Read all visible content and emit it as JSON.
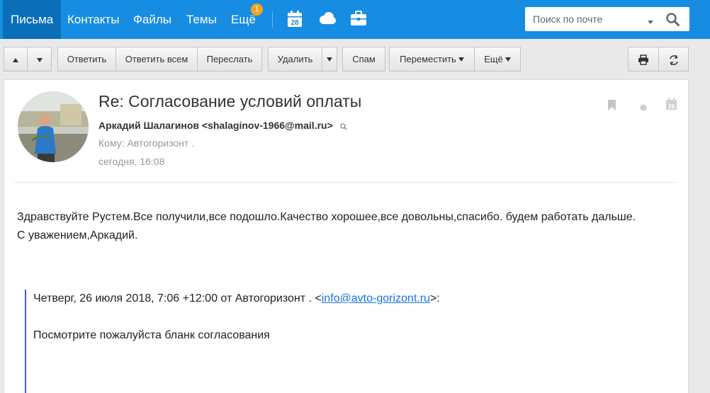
{
  "nav": {
    "items": [
      {
        "label": "Письма",
        "active": true
      },
      {
        "label": "Контакты"
      },
      {
        "label": "Файлы"
      },
      {
        "label": "Темы"
      },
      {
        "label": "Ещё"
      }
    ],
    "badge": "1",
    "calendar_day": "28",
    "search_placeholder": "Поиск по почте"
  },
  "toolbar": {
    "reply": "Ответить",
    "reply_all": "Ответить всем",
    "forward": "Переслать",
    "delete": "Удалить",
    "spam": "Спам",
    "move": "Переместить",
    "more": "Ещё"
  },
  "message": {
    "subject": "Re: Согласование условий оплаты",
    "sender": "Аркадий Шалагинов <shalaginov-1966@mail.ru>",
    "to": "Кому: Автогоризонт .",
    "date": "сегодня, 16:08",
    "calendar_day": "28",
    "body_line1": "Здравствуйте Рустем.Все получили,все подошло.Качество хорошее,все довольны,спасибо. будем работать дальше.",
    "body_line2": "С уважением,Аркадий.",
    "quote_prefix": "Четверг, 26 июля 2018, 7:06 +12:00 от Автогоризонт . <",
    "quote_link": "info@avto-gorizont.ru",
    "quote_suffix": ">:",
    "quote_body": "Посмотрите пожалуйста бланк согласования"
  },
  "colors": {
    "topbar": "#168de2",
    "active_tab": "#0a6fb8",
    "badge": "#f7a21b",
    "quote_bar": "#3a5fcd",
    "link": "#1a73e8"
  },
  "icons": [
    "calendar-icon",
    "cloud-icon",
    "briefcase-icon",
    "search-icon",
    "arrow-up-icon",
    "arrow-down-icon",
    "print-icon",
    "translate-icon",
    "bookmark-icon",
    "unread-dot-icon",
    "calendar-small-icon"
  ]
}
